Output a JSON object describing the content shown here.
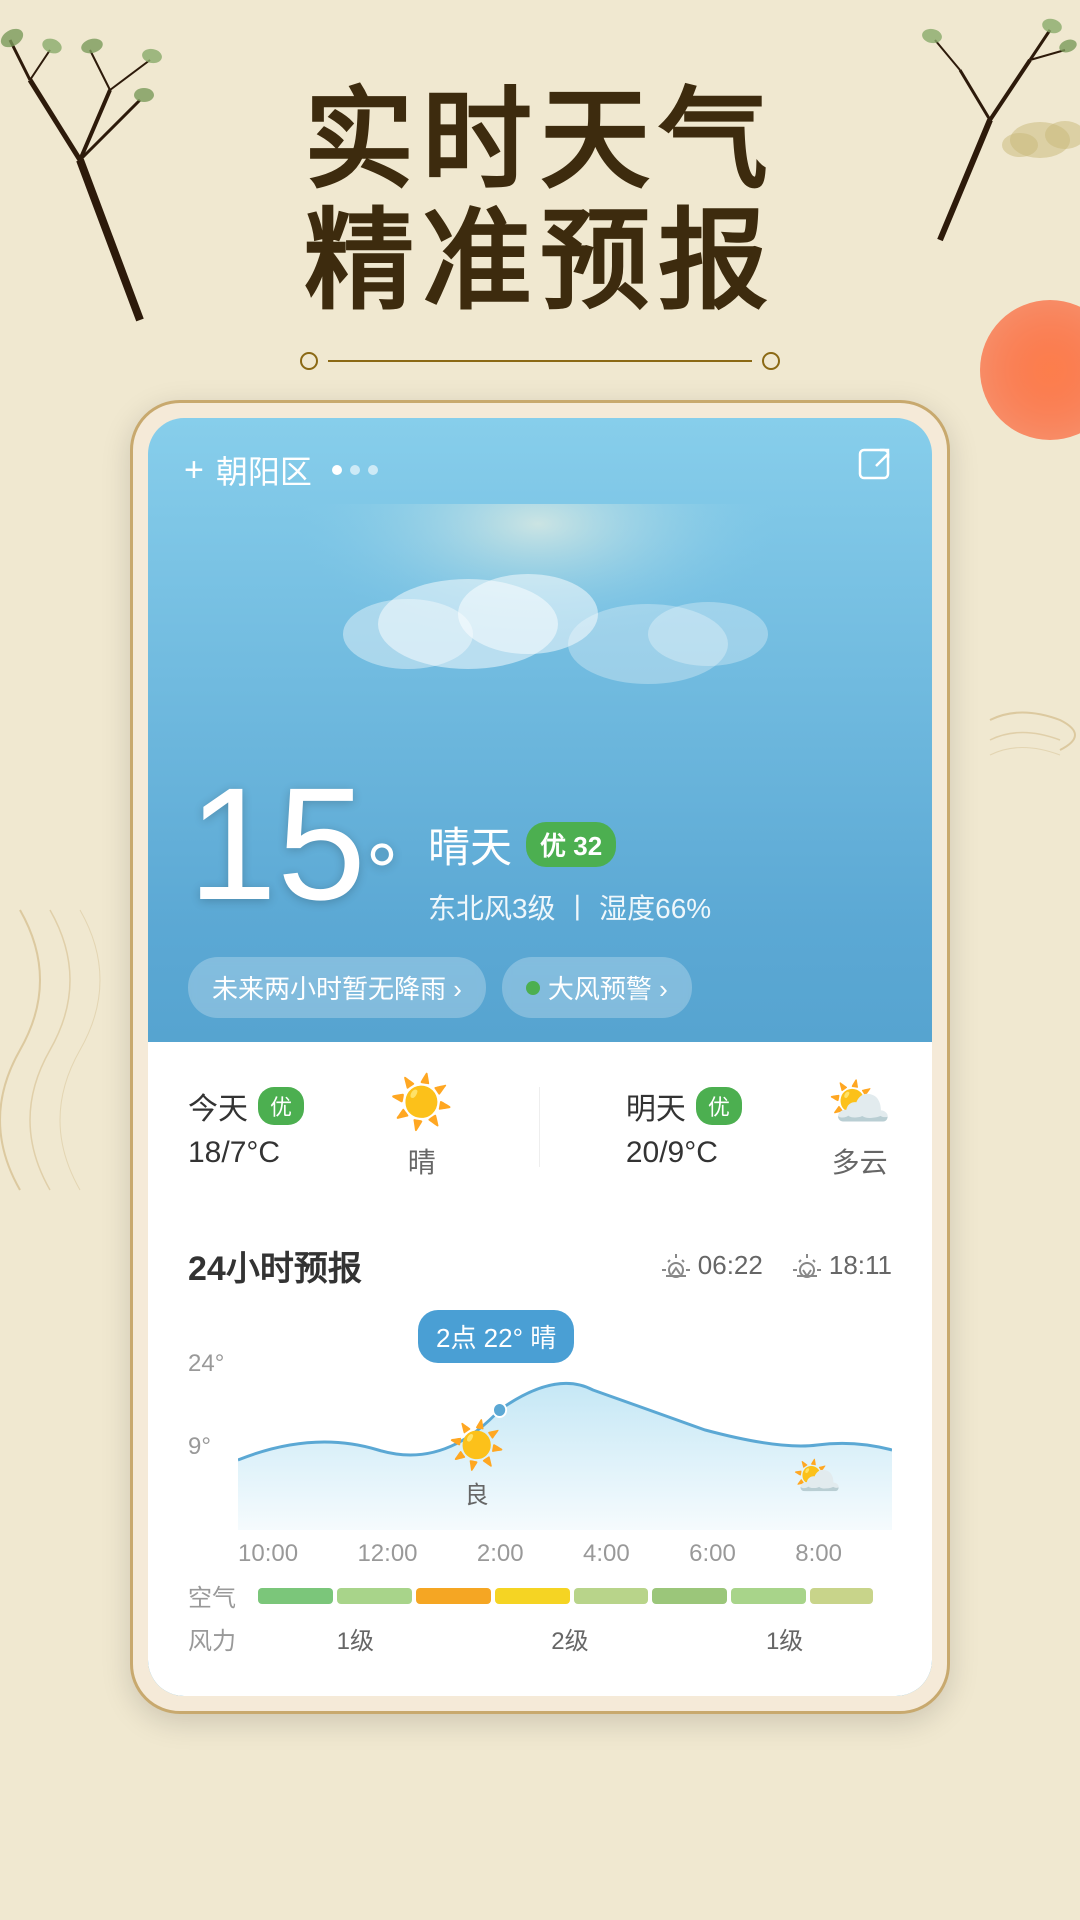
{
  "app": {
    "title_line1": "实时天气",
    "title_line2": "精准预报"
  },
  "header": {
    "plus_icon": "+",
    "location": "朝阳区",
    "share_icon": "⬡"
  },
  "current_weather": {
    "temperature": "15",
    "degree": "°",
    "condition": "晴天",
    "aqi_label": "优",
    "aqi_value": "32",
    "wind": "东北风3级",
    "separator": "丨",
    "humidity": "湿度66%",
    "alert1": "未来两小时暂无降雨 ›",
    "alert2": "大风预警 ›"
  },
  "daily_forecast": [
    {
      "label": "今天",
      "aqi": "优",
      "temp": "18/7°C",
      "condition": "晴",
      "icon": "☀️"
    },
    {
      "label": "明天",
      "aqi": "优",
      "temp": "20/9°C",
      "condition": "多云",
      "icon": "⛅"
    }
  ],
  "forecast_24h": {
    "title": "24小时预报",
    "sunrise": "06:22",
    "sunset": "18:11",
    "tooltip": "2点 22° 晴",
    "y_labels": [
      "24°",
      "9°"
    ],
    "time_labels": [
      "10:00",
      "12:00",
      "2:00",
      "4:00",
      "6:00",
      "8:00"
    ],
    "weather_icons": [
      {
        "time": "2:00",
        "icon": "☀️",
        "condition": "良"
      },
      {
        "time": "6:00",
        "icon": "⛅",
        "condition": ""
      }
    ],
    "air_quality_label": "空气",
    "wind_label": "风力",
    "wind_levels": [
      "1级",
      "2级",
      "1级"
    ]
  },
  "colors": {
    "sky_blue": "#5BA8D4",
    "aqi_green": "#4CAF50",
    "gold": "#8B6914",
    "bg": "#f0e8d0",
    "card_bg": "#f5ead8",
    "text_dark": "#3d2b0e"
  }
}
